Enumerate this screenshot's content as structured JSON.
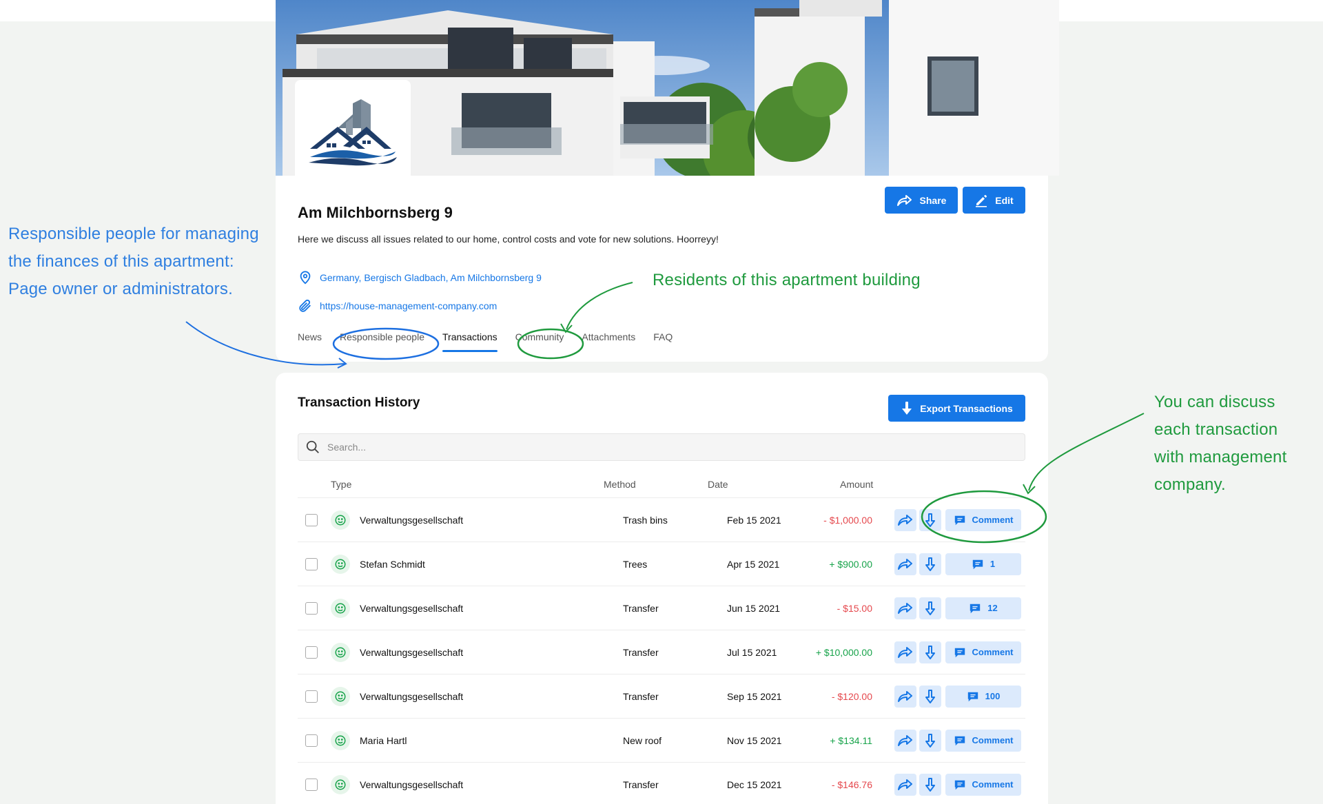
{
  "page": {
    "title": "Am Milchbornsberg 9",
    "description": "Here we discuss all issues related to our home, control costs and vote for new solutions. Hoorreyy!",
    "location": "Germany, Bergisch Gladbach, Am Milchbornsberg 9",
    "website": "https://house-management-company.com",
    "share_label": "Share",
    "edit_label": "Edit"
  },
  "tabs": [
    {
      "label": "News",
      "active": false
    },
    {
      "label": "Responsible people",
      "active": false
    },
    {
      "label": "Transactions",
      "active": true
    },
    {
      "label": "Community",
      "active": false
    },
    {
      "label": "Attachments",
      "active": false
    },
    {
      "label": "FAQ",
      "active": false
    }
  ],
  "transactions": {
    "title": "Transaction History",
    "export_label": "Export Transactions",
    "search_placeholder": "Search...",
    "columns": {
      "type": "Type",
      "method": "Method",
      "date": "Date",
      "amount": "Amount"
    },
    "rows": [
      {
        "name": "Verwaltungsgesellschaft",
        "method": "Trash bins",
        "date": "Feb 15 2021",
        "amount": "- $1,000.00",
        "sign": "neg",
        "comment": "Comment"
      },
      {
        "name": "Stefan Schmidt",
        "method": "Trees",
        "date": "Apr 15 2021",
        "amount": "+ $900.00",
        "sign": "pos",
        "comment": "1"
      },
      {
        "name": "Verwaltungsgesellschaft",
        "method": "Transfer",
        "date": "Jun 15 2021",
        "amount": "- $15.00",
        "sign": "neg",
        "comment": "12"
      },
      {
        "name": "Verwaltungsgesellschaft",
        "method": "Transfer",
        "date": "Jul 15 2021",
        "amount": "+ $10,000.00",
        "sign": "pos",
        "comment": "Comment"
      },
      {
        "name": "Verwaltungsgesellschaft",
        "method": "Transfer",
        "date": "Sep 15 2021",
        "amount": "- $120.00",
        "sign": "neg",
        "comment": "100"
      },
      {
        "name": "Maria Hartl",
        "method": "New roof",
        "date": "Nov 15 2021",
        "amount": "+ $134.11",
        "sign": "pos",
        "comment": "Comment"
      },
      {
        "name": "Verwaltungsgesellschaft",
        "method": "Transfer",
        "date": "Dec 15 2021",
        "amount": "- $146.76",
        "sign": "neg",
        "comment": "Comment"
      }
    ]
  },
  "annotations": {
    "responsible": [
      "Responsible people for managing",
      "the finances of this apartment:",
      "Page owner or administrators."
    ],
    "residents": "Residents of this apartment building",
    "discuss": [
      "You can discuss",
      "each transaction",
      "with management",
      "company."
    ]
  },
  "colors": {
    "accent": "#1677e6",
    "negative": "#e5484d",
    "positive": "#17a34a",
    "annotation_blue": "#2f7fe0",
    "annotation_green": "#1f9a3e"
  },
  "icons": {
    "location": "map-pin-icon",
    "website": "paperclip-icon",
    "share": "share-icon",
    "edit": "pencil-icon",
    "export": "download-icon",
    "search": "search-icon",
    "type": "smile-icon",
    "row_share": "share-icon",
    "row_download": "download-icon",
    "comment": "comment-icon"
  }
}
